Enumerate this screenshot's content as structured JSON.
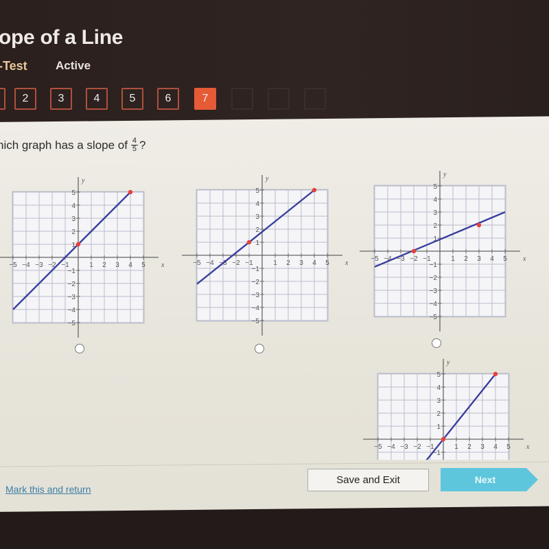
{
  "header": {
    "title": "ope of a Line",
    "subtitle": "-Test",
    "status": "Active",
    "question_nav": [
      {
        "label": "2",
        "state": "done"
      },
      {
        "label": "3",
        "state": "done"
      },
      {
        "label": "4",
        "state": "done"
      },
      {
        "label": "5",
        "state": "done"
      },
      {
        "label": "6",
        "state": "done"
      },
      {
        "label": "7",
        "state": "current"
      }
    ],
    "current_color": "#e65a36"
  },
  "question": {
    "text": "hich graph has a slope of",
    "numerator": "4",
    "denominator": "5",
    "suffix": "?"
  },
  "graphs": [
    {
      "x_label": "x",
      "y_label": "y",
      "range": [
        -5,
        5
      ],
      "line": [
        [
          -5,
          -4
        ],
        [
          4,
          5
        ]
      ],
      "points": [
        [
          0,
          1
        ],
        [
          4,
          5
        ]
      ],
      "selected": false
    },
    {
      "x_label": "x",
      "y_label": "y",
      "range": [
        -5,
        5
      ],
      "line": [
        [
          -5,
          -2.2
        ],
        [
          4,
          5
        ]
      ],
      "points": [
        [
          -1,
          1
        ],
        [
          4,
          5
        ]
      ],
      "selected": false
    },
    {
      "x_label": "x",
      "y_label": "y",
      "range": [
        -5,
        5
      ],
      "line": [
        [
          -5,
          -1.2
        ],
        [
          5,
          3
        ]
      ],
      "points": [
        [
          -2,
          0
        ],
        [
          3,
          2
        ]
      ],
      "selected": false
    },
    {
      "x_label": "x",
      "y_label": "y",
      "range": [
        -5,
        5
      ],
      "line": [
        [
          -1.6,
          -2
        ],
        [
          4,
          5
        ]
      ],
      "points": [
        [
          0,
          0
        ],
        [
          4,
          5
        ]
      ],
      "selected": false
    }
  ],
  "colors": {
    "line": "#3a3f9e",
    "point": "#e8413a",
    "grid": "#b9bccb",
    "accent": "#5ec6dc"
  },
  "footer": {
    "mark_link": "Mark this and return",
    "save_label": "Save and Exit",
    "next_label": "Next"
  }
}
